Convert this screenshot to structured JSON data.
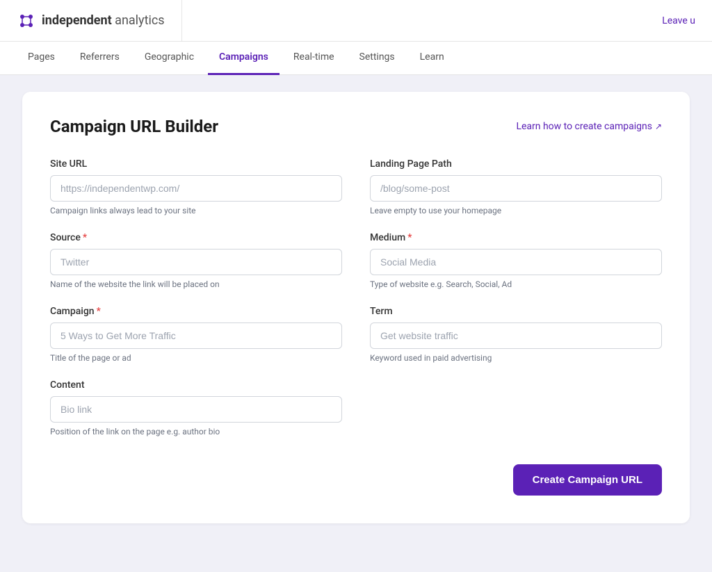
{
  "app": {
    "name_bold": "independent",
    "name_light": " analytics",
    "leave_label": "Leave u"
  },
  "nav": {
    "items": [
      {
        "label": "Pages",
        "id": "pages",
        "active": false
      },
      {
        "label": "Referrers",
        "id": "referrers",
        "active": false
      },
      {
        "label": "Geographic",
        "id": "geographic",
        "active": false
      },
      {
        "label": "Campaigns",
        "id": "campaigns",
        "active": true
      },
      {
        "label": "Real-time",
        "id": "realtime",
        "active": false
      },
      {
        "label": "Settings",
        "id": "settings",
        "active": false
      },
      {
        "label": "Learn",
        "id": "learn",
        "active": false
      }
    ]
  },
  "page": {
    "title": "Campaign URL Builder",
    "learn_link": "Learn how to create campaigns"
  },
  "form": {
    "site_url": {
      "label": "Site URL",
      "placeholder": "https://independentwp.com/",
      "hint": "Campaign links always lead to your site"
    },
    "landing_page_path": {
      "label": "Landing Page Path",
      "placeholder": "/blog/some-post",
      "hint": "Leave empty to use your homepage"
    },
    "source": {
      "label": "Source",
      "required": true,
      "placeholder": "Twitter",
      "hint": "Name of the website the link will be placed on"
    },
    "medium": {
      "label": "Medium",
      "required": true,
      "placeholder": "Social Media",
      "hint": "Type of website e.g. Search, Social, Ad"
    },
    "campaign": {
      "label": "Campaign",
      "required": true,
      "placeholder": "5 Ways to Get More Traffic",
      "hint": "Title of the page or ad"
    },
    "term": {
      "label": "Term",
      "required": false,
      "placeholder": "Get website traffic",
      "hint": "Keyword used in paid advertising"
    },
    "content": {
      "label": "Content",
      "required": false,
      "placeholder": "Bio link",
      "hint": "Position of the link on the page e.g. author bio"
    },
    "submit_label": "Create Campaign URL"
  }
}
